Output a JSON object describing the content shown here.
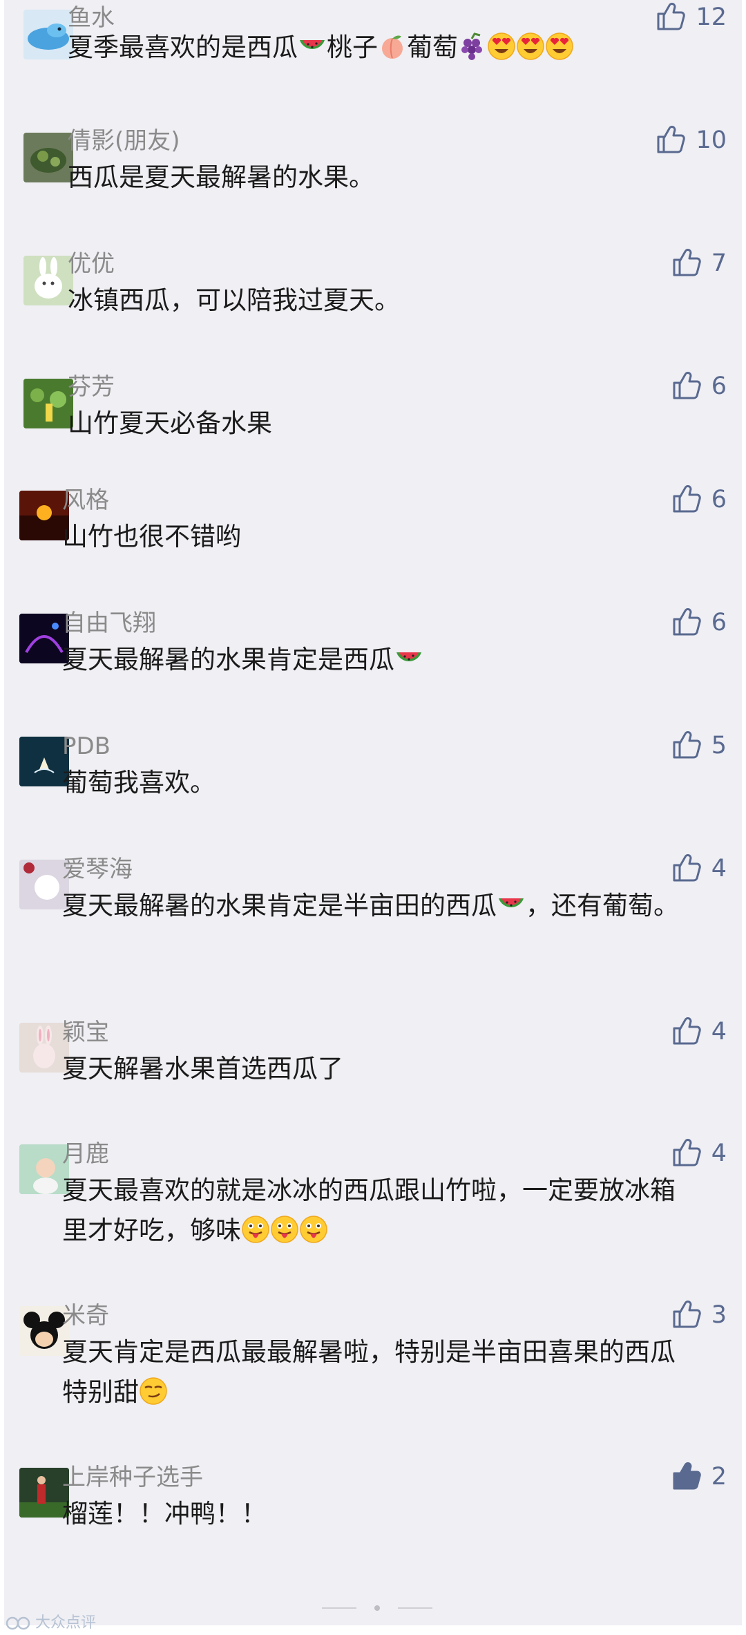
{
  "comments": [
    {
      "name": "鱼水",
      "likes": "12",
      "text_a": "夏季最喜欢的是西瓜",
      "text_b": "桃子",
      "text_c": "葡萄"
    },
    {
      "name": "倩影(朋友)",
      "likes": "10",
      "text": "西瓜是夏天最解暑的水果。"
    },
    {
      "name": "优优",
      "likes": "7",
      "text": "冰镇西瓜，可以陪我过夏天。"
    },
    {
      "name": "芬芳",
      "likes": "6",
      "text": "山竹夏天必备水果"
    },
    {
      "name": "风格",
      "likes": "6",
      "text": "山竹也很不错哟"
    },
    {
      "name": "自由飞翔",
      "likes": "6",
      "text": "夏天最解暑的水果肯定是西瓜"
    },
    {
      "name": "PDB",
      "likes": "5",
      "text": "葡萄我喜欢。"
    },
    {
      "name": "爱琴海",
      "likes": "4",
      "text_a": "夏天最解暑的水果肯定是半亩田的西瓜",
      "text_b": "，还有葡萄。"
    },
    {
      "name": "颖宝",
      "likes": "4",
      "text": "夏天解暑水果首选西瓜了"
    },
    {
      "name": "月鹿",
      "likes": "4",
      "text": "夏天最喜欢的就是冰冰的西瓜跟山竹啦，一定要放冰箱里才好吃，够味"
    },
    {
      "name": "米奇",
      "likes": "3",
      "text": "夏天肯定是西瓜最最解暑啦，特别是半亩田喜果的西瓜特别甜"
    },
    {
      "name": "上岸种子选手",
      "likes": "2",
      "text": "榴莲！！冲鸭！！"
    }
  ],
  "watermark": "大众点评",
  "colors": {
    "background": "#efeff4",
    "name": "#8a8a8a",
    "text": "#1b1b1b",
    "like": "#59698f"
  },
  "icons": [
    "thumbs-up-icon",
    "thumbs-up-filled-icon",
    "watermelon-emoji",
    "peach-emoji",
    "grapes-emoji",
    "heart-eyes-emoji",
    "tongue-out-emoji",
    "smirk-emoji"
  ]
}
